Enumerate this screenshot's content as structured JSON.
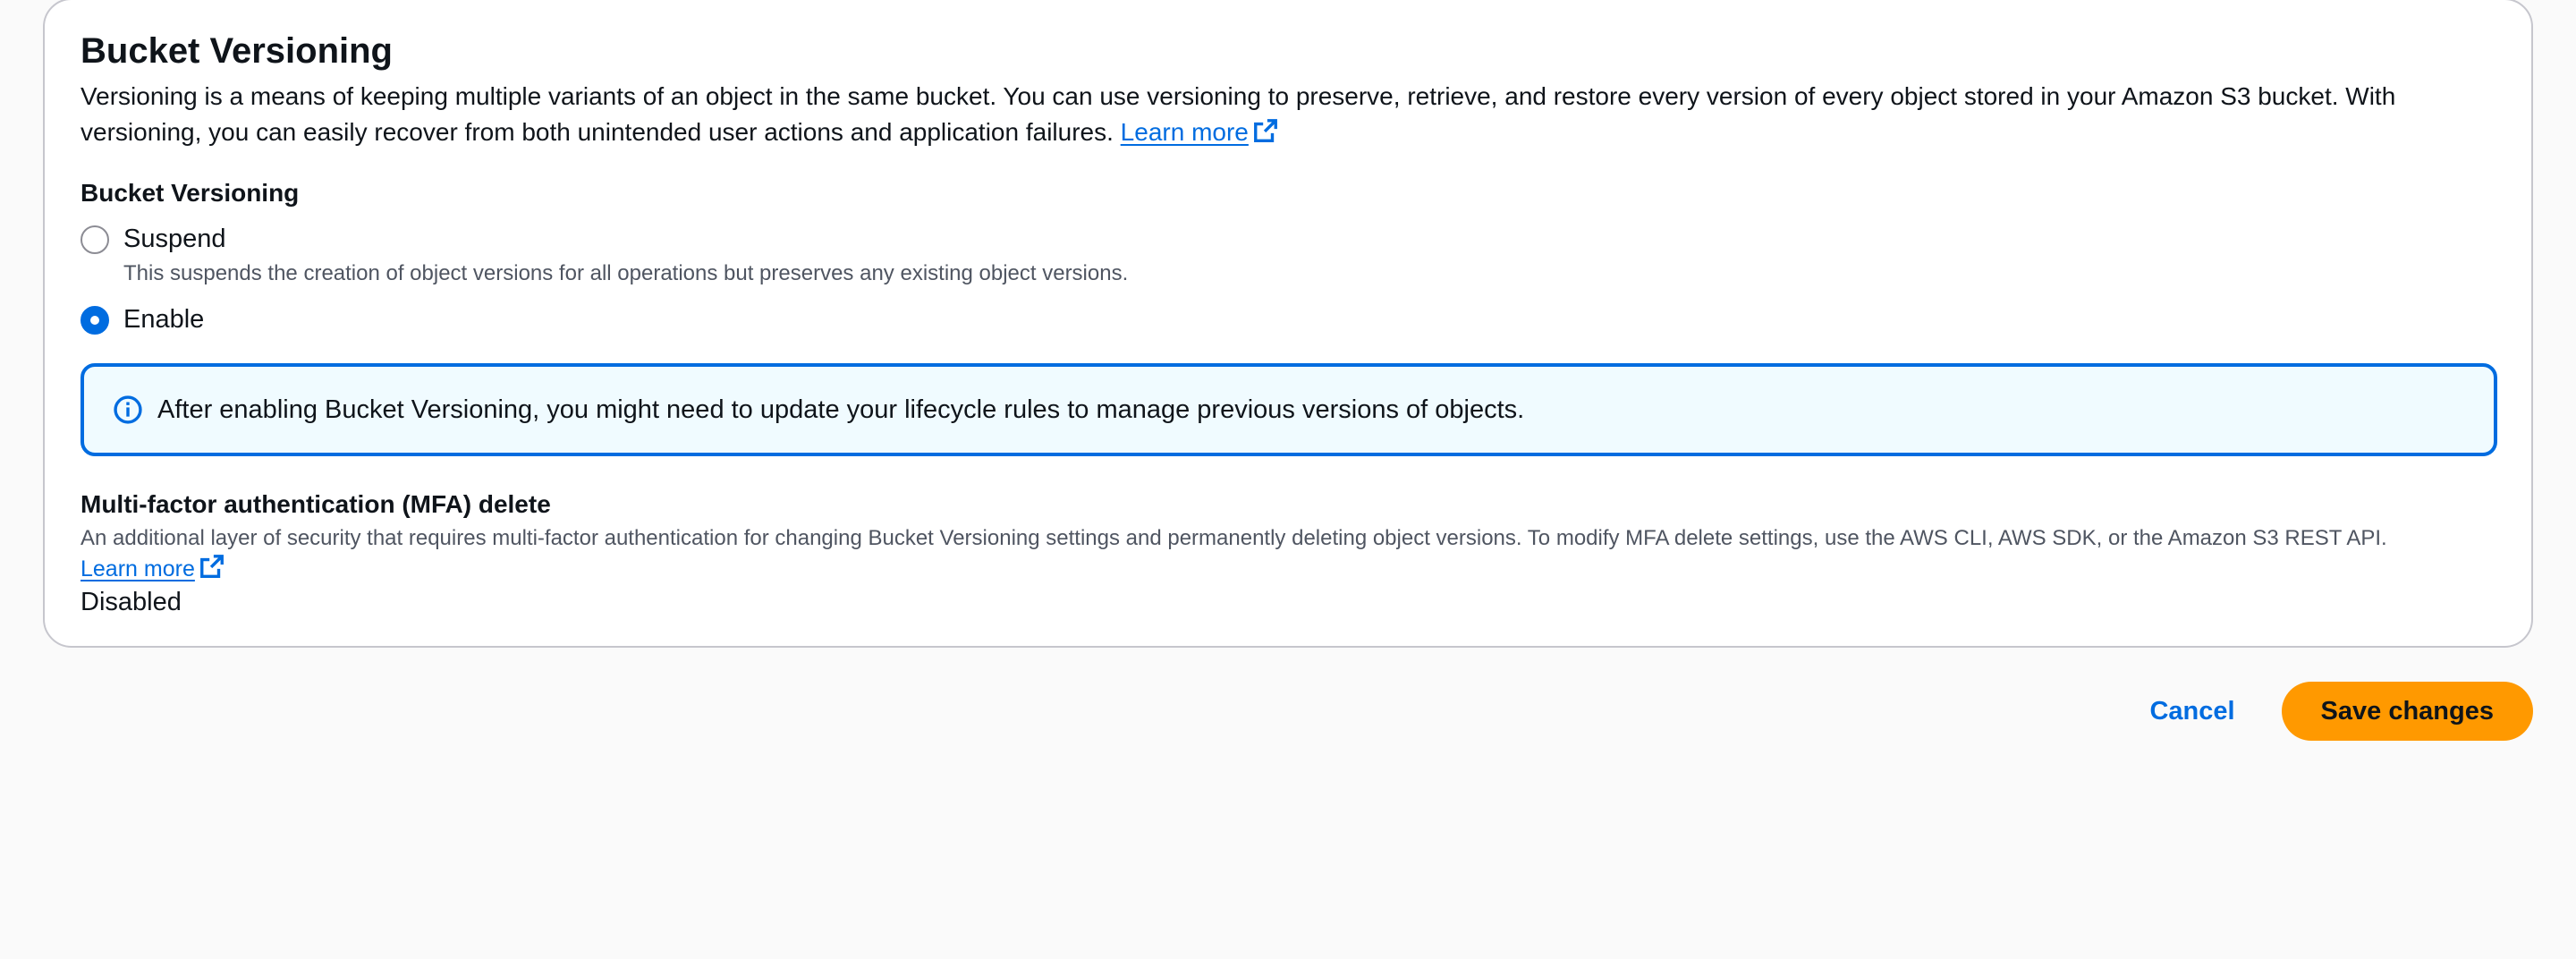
{
  "versioning_panel": {
    "title": "Bucket Versioning",
    "description": "Versioning is a means of keeping multiple variants of an object in the same bucket. You can use versioning to preserve, retrieve, and restore every version of every object stored in your Amazon S3 bucket. With versioning, you can easily recover from both unintended user actions and application failures.",
    "learn_more": "Learn more",
    "field_label": "Bucket Versioning",
    "options": [
      {
        "label": "Suspend",
        "help": "This suspends the creation of object versions for all operations but preserves any existing object versions.",
        "selected": false
      },
      {
        "label": "Enable",
        "selected": true
      }
    ],
    "alert": {
      "icon": "info-icon",
      "text": "After enabling Bucket Versioning, you might need to update your lifecycle rules to manage previous versions of objects."
    },
    "mfa": {
      "label": "Multi-factor authentication (MFA) delete",
      "description": "An additional layer of security that requires multi-factor authentication for changing Bucket Versioning settings and permanently deleting object versions. To modify MFA delete settings, use the AWS CLI, AWS SDK, or the Amazon S3 REST API.",
      "learn_more": "Learn more",
      "value": "Disabled"
    }
  },
  "actions": {
    "cancel_label": "Cancel",
    "save_label": "Save changes"
  },
  "colors": {
    "accent": "#006ce0",
    "primary_button": "#ff9900",
    "alert_background": "#f0fbff"
  }
}
